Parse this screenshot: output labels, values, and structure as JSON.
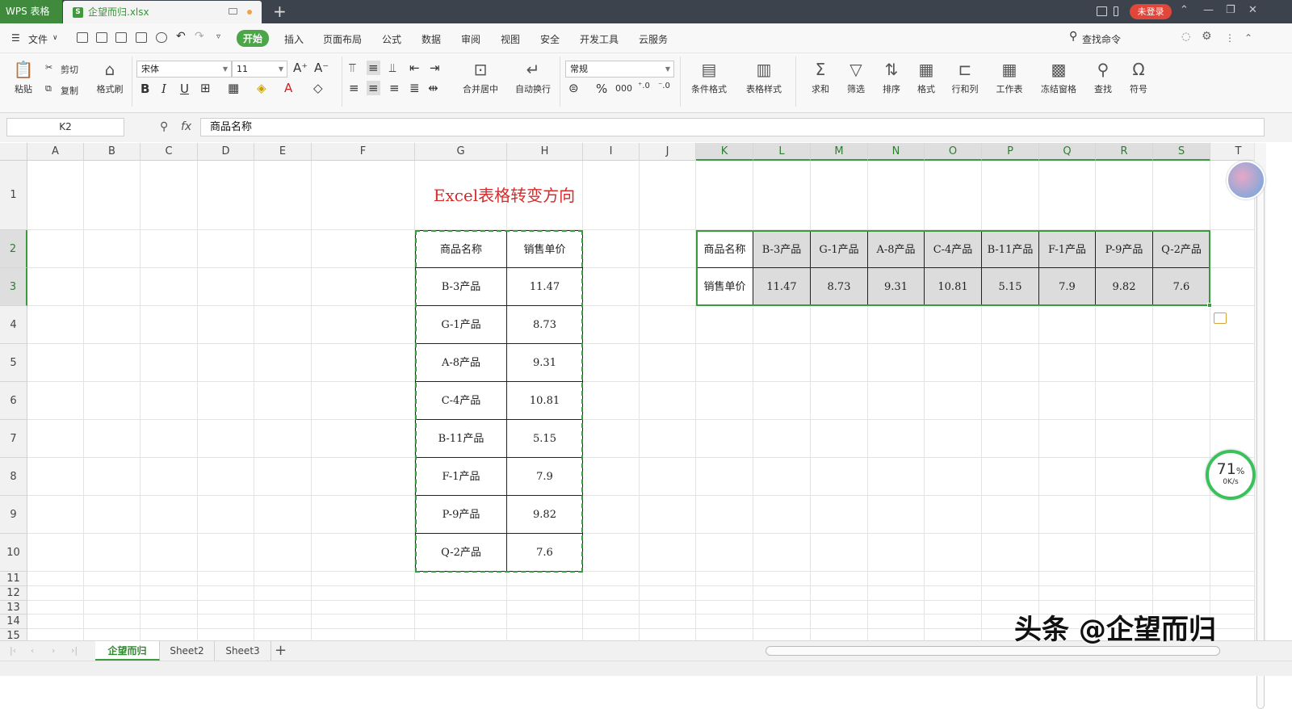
{
  "titlebar": {
    "app_label": "WPS 表格",
    "tab_icon": "S",
    "tab_title": "企望而归.xlsx",
    "new_tab": "+",
    "login": "未登录"
  },
  "menu": {
    "file": "文件",
    "items": [
      "开始",
      "插入",
      "页面布局",
      "公式",
      "数据",
      "审阅",
      "视图",
      "安全",
      "开发工具",
      "云服务"
    ],
    "search": "查找命令"
  },
  "ribbon": {
    "paste": "粘贴",
    "cut": "剪切",
    "copy": "复制",
    "format_painter": "格式刷",
    "font_name": "宋体",
    "font_size": "11",
    "bold": "B",
    "italic": "I",
    "underline": "U",
    "merge_center": "合并居中",
    "wrap": "自动换行",
    "number_format": "常规",
    "percent": "%",
    "thousands": "000",
    "conditional": "条件格式",
    "table_style": "表格样式",
    "sum": "求和",
    "filter": "筛选",
    "sort": "排序",
    "format": "格式",
    "rowcol": "行和列",
    "worksheet": "工作表",
    "freeze": "冻结窗格",
    "find": "查找",
    "symbol": "符号"
  },
  "formula_bar": {
    "name_box": "K2",
    "fx": "fx",
    "content": "商品名称"
  },
  "columns": [
    "A",
    "B",
    "C",
    "D",
    "E",
    "F",
    "G",
    "H",
    "I",
    "J",
    "K",
    "L",
    "M",
    "N",
    "O",
    "P",
    "Q",
    "R",
    "S",
    "T"
  ],
  "rows": [
    "1",
    "2",
    "3",
    "4",
    "5",
    "6",
    "7",
    "8",
    "9",
    "10",
    "11",
    "12",
    "13",
    "14",
    "15"
  ],
  "sheet_title": "Excel表格转变方向",
  "source_table": {
    "headers": [
      "商品名称",
      "销售单价"
    ],
    "rows": [
      [
        "B-3产品",
        "11.47"
      ],
      [
        "G-1产品",
        "8.73"
      ],
      [
        "A-8产品",
        "9.31"
      ],
      [
        "C-4产品",
        "10.81"
      ],
      [
        "B-11产品",
        "5.15"
      ],
      [
        "F-1产品",
        "7.9"
      ],
      [
        "P-9产品",
        "9.82"
      ],
      [
        "Q-2产品",
        "7.6"
      ]
    ]
  },
  "transposed_table": {
    "row1": [
      "商品名称",
      "B-3产品",
      "G-1产品",
      "A-8产品",
      "C-4产品",
      "B-11产品",
      "F-1产品",
      "P-9产品",
      "Q-2产品"
    ],
    "row2": [
      "销售单价",
      "11.47",
      "8.73",
      "9.31",
      "10.81",
      "5.15",
      "7.9",
      "9.82",
      "7.6"
    ]
  },
  "sheet_tabs": [
    "企望而归",
    "Sheet2",
    "Sheet3"
  ],
  "gauge": {
    "percent": "71",
    "unit": "%",
    "speed": "0K/s"
  },
  "watermark": "头条 @企望而归"
}
